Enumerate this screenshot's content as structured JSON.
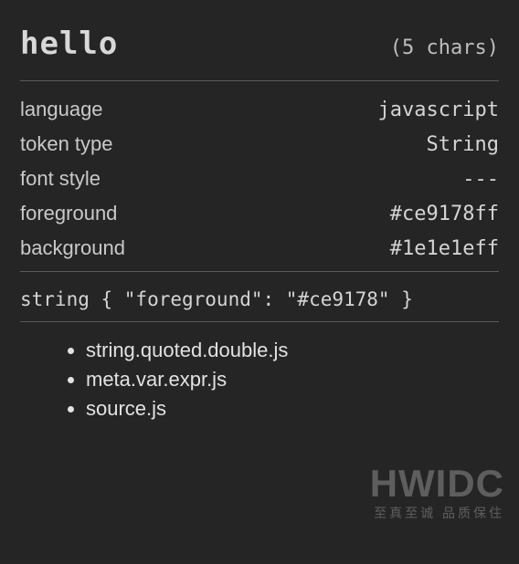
{
  "header": {
    "token_text": "hello",
    "char_count": "(5 chars)"
  },
  "props": [
    {
      "label": "language",
      "value": "javascript"
    },
    {
      "label": "token type",
      "value": "String"
    },
    {
      "label": "font style",
      "value": "---"
    },
    {
      "label": "foreground",
      "value": "#ce9178ff"
    },
    {
      "label": "background",
      "value": "#1e1e1eff"
    }
  ],
  "rule": "string { \"foreground\": \"#ce9178\" }",
  "scopes": [
    "string.quoted.double.js",
    "meta.var.expr.js",
    "source.js"
  ],
  "watermark": {
    "big": "HWIDC",
    "small": "至真至诚 品质保住"
  }
}
